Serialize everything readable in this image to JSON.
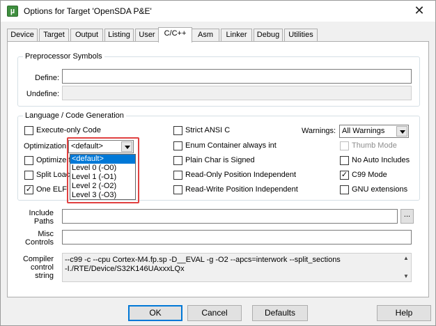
{
  "window": {
    "title": "Options for Target 'OpenSDA P&E'",
    "app_icon_letter": "µ",
    "close_glyph": "✕"
  },
  "tabs": [
    {
      "label": "Device",
      "active": false
    },
    {
      "label": "Target",
      "active": false
    },
    {
      "label": "Output",
      "active": false
    },
    {
      "label": "Listing",
      "active": false
    },
    {
      "label": "User",
      "active": false
    },
    {
      "label": "C/C++",
      "active": true
    },
    {
      "label": "Asm",
      "active": false
    },
    {
      "label": "Linker",
      "active": false
    },
    {
      "label": "Debug",
      "active": false
    },
    {
      "label": "Utilities",
      "active": false
    }
  ],
  "preprocessor": {
    "legend": "Preprocessor Symbols",
    "define_label": "Define:",
    "define_value": "",
    "undefine_label": "Undefine:",
    "undefine_value": ""
  },
  "language": {
    "legend": "Language / Code Generation",
    "execute_only": {
      "label": "Execute-only Code",
      "checked": false
    },
    "optimization_label": "Optimization:",
    "optimization_value": "<default>",
    "optimize_for_time": {
      "label": "Optimize f",
      "checked": false
    },
    "split_load": {
      "label": "Split Loac",
      "checked": false
    },
    "one_elf": {
      "label": "One ELF",
      "checked": true
    },
    "strict_ansi": {
      "label": "Strict ANSI C",
      "checked": false
    },
    "enum_container": {
      "label": "Enum Container always int",
      "checked": false
    },
    "plain_char": {
      "label": "Plain Char is Signed",
      "checked": false
    },
    "ro_position": {
      "label": "Read-Only Position Independent",
      "checked": false
    },
    "rw_position": {
      "label": "Read-Write Position Independent",
      "checked": false
    },
    "warnings_label": "Warnings:",
    "warnings_value": "All Warnings",
    "thumb_mode": {
      "label": "Thumb Mode",
      "checked": false,
      "disabled": true
    },
    "no_auto_includes": {
      "label": "No Auto Includes",
      "checked": false
    },
    "c99_mode": {
      "label": "C99 Mode",
      "checked": true
    },
    "gnu_extensions": {
      "label": "GNU extensions",
      "checked": false
    }
  },
  "optimization_dropdown": {
    "options": [
      "<default>",
      "Level 0 (-O0)",
      "Level 1 (-O1)",
      "Level 2 (-O2)",
      "Level 3 (-O3)"
    ],
    "selected_index": 0
  },
  "include": {
    "label_line1": "Include",
    "label_line2": "Paths",
    "value": "",
    "browse_label": "..."
  },
  "misc": {
    "label_line1": "Misc",
    "label_line2": "Controls",
    "value": ""
  },
  "compiler": {
    "label_line1": "Compiler",
    "label_line2": "control",
    "label_line3": "string",
    "line1": "--c99 -c --cpu Cortex-M4.fp.sp -D__EVAL -g -O2 --apcs=interwork --split_sections",
    "line2": "-I./RTE/Device/S32K146UAxxxLQx",
    "scroll_up": "▲",
    "scroll_down": "▼"
  },
  "buttons": {
    "ok": "OK",
    "cancel": "Cancel",
    "defaults": "Defaults",
    "help": "Help"
  },
  "checkmark": "✓"
}
